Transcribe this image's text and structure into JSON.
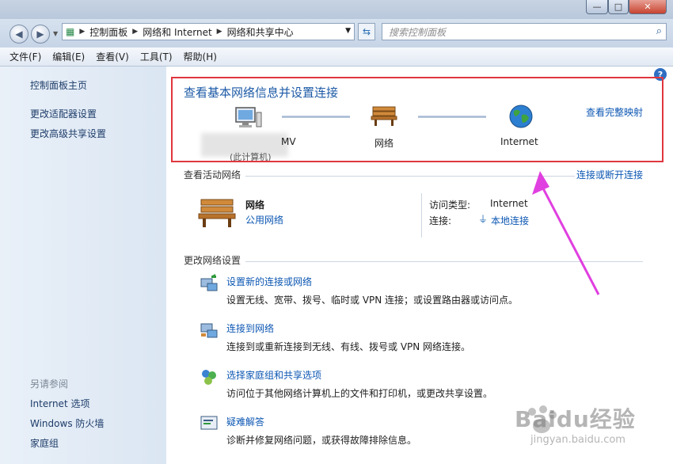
{
  "address": {
    "segments": [
      "控制面板",
      "网络和 Internet",
      "网络和共享中心"
    ],
    "search_placeholder": "搜索控制面板"
  },
  "menu": [
    "文件(F)",
    "编辑(E)",
    "查看(V)",
    "工具(T)",
    "帮助(H)"
  ],
  "sidebar": {
    "links": [
      "控制面板主页",
      "更改适配器设置",
      "更改高级共享设置"
    ],
    "see_also_header": "另请参阅",
    "see_also": [
      "Internet 选项",
      "Windows 防火墙",
      "家庭组"
    ]
  },
  "main": {
    "title": "查看基本网络信息并设置连接",
    "full_map_link": "查看完整映射",
    "nodes": {
      "computer_label": "MV",
      "computer_sublabel": "(此计算机)",
      "network_label": "网络",
      "internet_label": "Internet"
    },
    "active_section": {
      "title": "查看活动网络",
      "connect_link": "连接或断开连接",
      "network_name": "网络",
      "network_type": "公用网络",
      "access_type_label": "访问类型:",
      "access_type_value": "Internet",
      "connections_label": "连接:",
      "connections_value": "本地连接"
    },
    "change_section": {
      "title": "更改网络设置",
      "tasks": [
        {
          "title": "设置新的连接或网络",
          "desc": "设置无线、宽带、拨号、临时或 VPN 连接；或设置路由器或访问点。",
          "icon": "new-connection-icon"
        },
        {
          "title": "连接到网络",
          "desc": "连接到或重新连接到无线、有线、拨号或 VPN 网络连接。",
          "icon": "connect-network-icon"
        },
        {
          "title": "选择家庭组和共享选项",
          "desc": "访问位于其他网络计算机上的文件和打印机，或更改共享设置。",
          "icon": "homegroup-icon"
        },
        {
          "title": "疑难解答",
          "desc": "诊断并修复网络问题，或获得故障排除信息。",
          "icon": "troubleshoot-icon"
        }
      ]
    }
  },
  "watermark": {
    "text": "Baidu经验",
    "url": "jingyan.baidu.com"
  },
  "colors": {
    "highlight_border": "#e0363e",
    "annotation_arrow": "#e040e0",
    "link": "#0d57b3"
  }
}
